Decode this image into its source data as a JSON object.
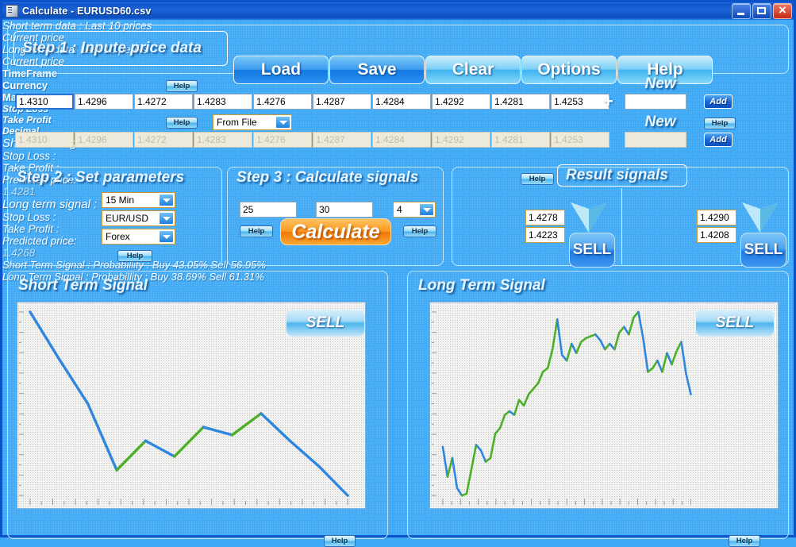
{
  "window": {
    "title": "Calculate - EURUSD60.csv",
    "icon": "app-icon",
    "minimize": "minimize",
    "maximize": "maximize",
    "close": "close"
  },
  "step1": {
    "header": "Step 1 : Inpute price data",
    "buttons": [
      {
        "label": "Load",
        "style": "dark"
      },
      {
        "label": "Save",
        "style": "dark"
      },
      {
        "label": "Clear",
        "style": "light"
      },
      {
        "label": "Options",
        "style": "light"
      },
      {
        "label": "Help",
        "style": "light"
      }
    ],
    "short_label": "Short term data : Last 10 prices",
    "short_help": "Help",
    "short_values": [
      "1.4310",
      "1.4296",
      "1.4272",
      "1.4283",
      "1.4276",
      "1.4287",
      "1.4284",
      "1.4292",
      "1.4281",
      "1.4253"
    ],
    "short_current_price_label": "Current price",
    "short_new_label": "New",
    "short_new_value": "",
    "short_add": "Add",
    "long_label": "Long term data: Last 10 peaks",
    "long_help": "Help",
    "long_source": "From File",
    "long_values": [
      "1.4310",
      "1.4296",
      "1.4272",
      "1.4283",
      "1.4276",
      "1.4287",
      "1.4284",
      "1.4292",
      "1.4281",
      "1.4253"
    ],
    "long_current_price_label": "Current price",
    "long_new_label": "New",
    "long_new_value": "",
    "long_add": "Add",
    "long_row_help": "Help",
    "plus": "+"
  },
  "step2": {
    "header": "Step 2 : Set parameters",
    "timeframe_label": "TimeFrame",
    "timeframe_value": "15 Min",
    "currency_label": "Currency",
    "currency_value": "EUR/USD",
    "market_label": "Market",
    "market_value": "Forex",
    "help": "Help"
  },
  "step3": {
    "header": "Step 3 : Calculate signals",
    "stop_loss_label": "Stop Loss",
    "stop_loss_value": "25",
    "take_profit_label": "Take Profit",
    "take_profit_value": "30",
    "decimal_label": "Decimal",
    "decimal_value": "4",
    "help_left": "Help",
    "help_right": "Help",
    "calculate": "Calculate"
  },
  "results": {
    "header": "Result signals",
    "help": "Help",
    "short": {
      "title": "Short term signal :",
      "stop_loss_label": "Stop Loss :",
      "stop_loss_value": "1.4278",
      "take_profit_label": "Take Profit :",
      "take_profit_value": "1.4223",
      "predicted_label": "Predicted price:",
      "predicted_value": "1.4281",
      "signal": "SELL"
    },
    "long": {
      "title": "Long term signal :",
      "stop_loss_label": "Stop Loss :",
      "stop_loss_value": "1.4290",
      "take_profit_label": "Take Profit :",
      "take_profit_value": "1.4208",
      "predicted_label": "Predicted price:",
      "predicted_value": "1.4268",
      "signal": "SELL"
    }
  },
  "short_chart_panel": {
    "header": "Short Term Signal",
    "signal": "SELL",
    "footer": "Short Term Signal : Probabillity : Buy 43.05% Sell 56.95%",
    "footer_help": "Help"
  },
  "long_chart_panel": {
    "header": "Long Term Signal",
    "signal": "SELL",
    "footer": "Long Term Signal : Probabillity : Buy 38.69% Sell 61.31%",
    "footer_help": "Help"
  },
  "colors": {
    "background": "#3FA9F5",
    "title_bar": "#0A53C8",
    "line_down": "#2E86DE",
    "line_up": "#4CAF28",
    "accent_orange": "#F07808",
    "chart_bg": "#F2F2F0"
  },
  "chart_data": [
    {
      "type": "line",
      "title": "Short Term Signal",
      "xlabel": "",
      "ylabel": "",
      "grid": true,
      "legend": "none",
      "annotation": "SELL",
      "probability_buy": 43.05,
      "probability_sell": 56.95,
      "x": [
        0,
        1,
        2,
        3,
        4,
        5,
        6,
        7,
        8,
        9,
        10,
        11
      ],
      "values": [
        96,
        72,
        49,
        15,
        30,
        22,
        37,
        33,
        44,
        30,
        17,
        2
      ],
      "segment_colors": [
        "down",
        "down",
        "down",
        "up",
        "down",
        "up",
        "down",
        "up",
        "down",
        "down",
        "down"
      ]
    },
    {
      "type": "line",
      "title": "Long Term Signal",
      "xlabel": "",
      "ylabel": "",
      "grid": true,
      "legend": "none",
      "annotation": "SELL",
      "probability_buy": 38.69,
      "probability_sell": 61.31,
      "x": [
        0,
        1,
        2,
        3,
        4,
        5,
        6,
        7,
        8,
        9,
        10,
        11,
        12,
        13,
        14,
        15,
        16,
        17,
        18,
        19,
        20,
        21,
        22,
        23,
        24,
        25,
        26,
        27,
        28,
        29,
        30,
        31,
        32,
        33,
        34,
        35,
        36,
        37,
        38,
        39,
        40,
        41,
        42,
        43,
        44,
        45,
        46,
        47,
        48,
        49,
        50,
        51,
        52
      ],
      "values": [
        28,
        12,
        22,
        6,
        2,
        3,
        16,
        29,
        26,
        20,
        22,
        35,
        38,
        45,
        47,
        45,
        53,
        50,
        56,
        59,
        62,
        68,
        70,
        80,
        96,
        77,
        74,
        83,
        78,
        84,
        86,
        87,
        88,
        85,
        80,
        83,
        80,
        89,
        92,
        88,
        97,
        100,
        86,
        68,
        70,
        74,
        68,
        78,
        72,
        79,
        84,
        67,
        56
      ],
      "segment_colors": [
        "down",
        "up",
        "down",
        "down",
        "up",
        "up",
        "up",
        "down",
        "down",
        "up",
        "up",
        "up",
        "up",
        "up",
        "down",
        "up",
        "up",
        "up",
        "up",
        "up",
        "up",
        "up",
        "up",
        "up",
        "down",
        "down",
        "up",
        "down",
        "up",
        "up",
        "up",
        "up",
        "down",
        "down",
        "up",
        "down",
        "up",
        "up",
        "down",
        "up",
        "up",
        "down",
        "down",
        "up",
        "up",
        "down",
        "up",
        "down",
        "up",
        "up",
        "down",
        "down"
      ]
    }
  ]
}
